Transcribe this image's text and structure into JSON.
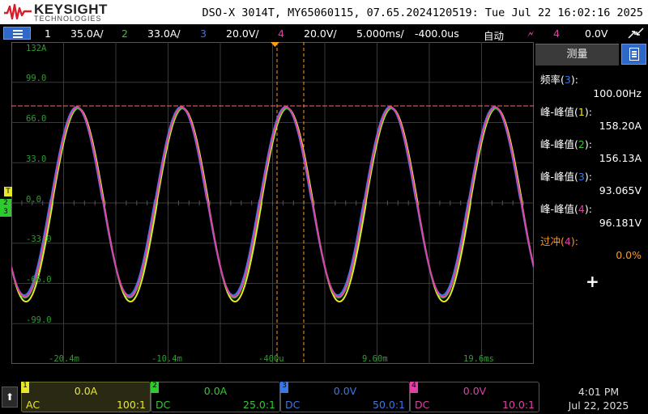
{
  "header": {
    "brand": "KEYSIGHT",
    "brand_sub": "TECHNOLOGIES",
    "title": "DSO-X 3014T, MY65060115, 07.65.2024120519: Tue Jul 22 16:02:16 2025"
  },
  "settings_bar": {
    "ch1_num": "1",
    "ch1_scale": "35.0A/",
    "ch2_num": "2",
    "ch2_scale": "33.0A/",
    "ch3_num": "3",
    "ch3_scale": "20.0V/",
    "ch4_num": "4",
    "ch4_scale": "20.0V/",
    "timebase": "5.000ms/",
    "delay": "-400.0us",
    "trigger_mode": "自动",
    "trigger_source": "4",
    "trigger_level": "0.0V"
  },
  "graticule": {
    "y_ticks": [
      "132A",
      "99.0",
      "66.0",
      "33.0",
      "0.0",
      "-33.0",
      "-66.0",
      "-99.0"
    ],
    "x_ticks": [
      "-20.4m",
      "-10.4m",
      "-400u",
      "9.60m",
      "19.6ms"
    ]
  },
  "chart_data": {
    "type": "line",
    "x_range_ms": [
      -25.4,
      24.6
    ],
    "period_ms": 10.0,
    "series": [
      {
        "channel": "1",
        "color": "#e8e82a",
        "peak_to_peak": "158.20A"
      },
      {
        "channel": "2",
        "color": "#2ecb2e",
        "peak_to_peak": "156.13A"
      },
      {
        "channel": "3",
        "color": "#3a78e8",
        "peak_to_peak": "93.065V"
      },
      {
        "channel": "4",
        "color": "#e040a8",
        "peak_to_peak": "96.181V"
      }
    ]
  },
  "measure_panel": {
    "tab_label": "测量",
    "items": [
      {
        "label": "频率",
        "ch": "3",
        "value": "100.00Hz"
      },
      {
        "label": "峰-峰值",
        "ch": "1",
        "value": "158.20A"
      },
      {
        "label": "峰-峰值",
        "ch": "2",
        "value": "156.13A"
      },
      {
        "label": "峰-峰值",
        "ch": "3",
        "value": "93.065V"
      },
      {
        "label": "峰-峰值",
        "ch": "4",
        "value": "96.181V"
      },
      {
        "label": "过冲",
        "ch": "4",
        "value": "0.0%"
      }
    ],
    "add_label": "+"
  },
  "channels": [
    {
      "offset": "0.0A",
      "coupling": "AC",
      "probe": "100:1",
      "color": "#e8e82a"
    },
    {
      "offset": "0.0A",
      "coupling": "DC",
      "probe": "25.0:1",
      "color": "#2ecb2e"
    },
    {
      "offset": "0.0V",
      "coupling": "DC",
      "probe": "50.0:1",
      "color": "#3a78e8"
    },
    {
      "offset": "0.0V",
      "coupling": "DC",
      "probe": "10.0:1",
      "color": "#e040a8"
    }
  ],
  "clock": {
    "time": "4:01 PM",
    "date": "Jul 22, 2025"
  },
  "colors": {
    "ch1": "#e8e82a",
    "ch2": "#2ecb2e",
    "ch3": "#3a78e8",
    "ch4": "#e040a8",
    "grid": "#2f9d2f",
    "accent": "#2f68c9",
    "cursor": "#ff9a1a"
  }
}
